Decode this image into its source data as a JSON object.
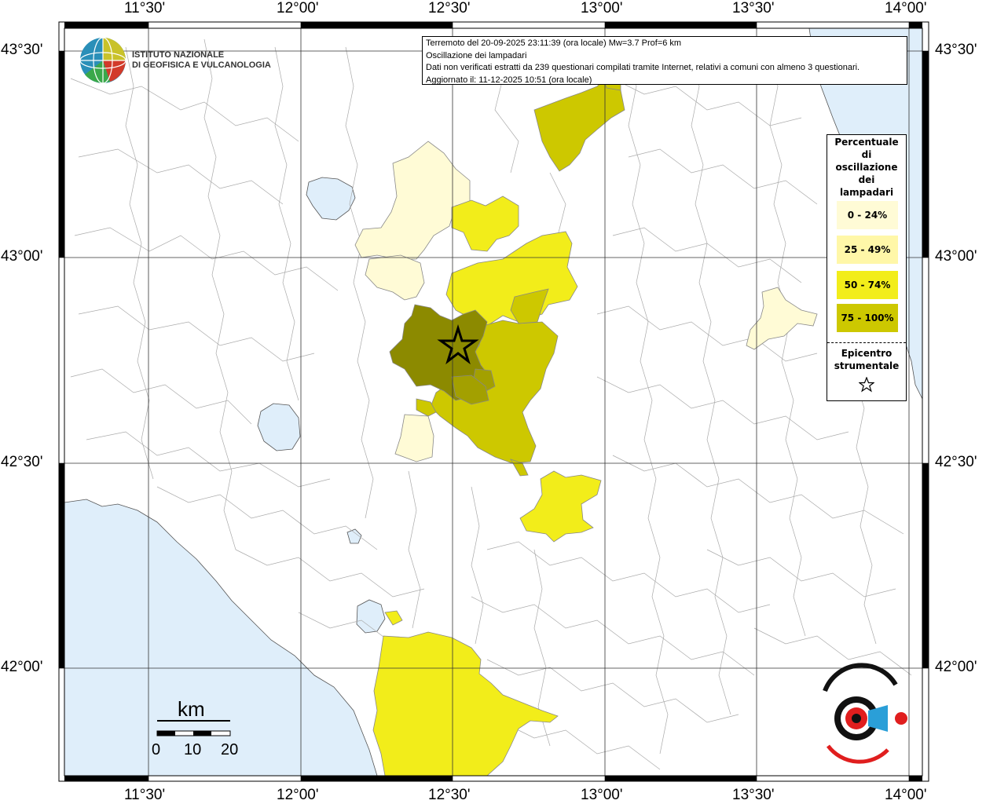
{
  "map": {
    "ticks_lon": [
      "11°30'",
      "12°00'",
      "12°30'",
      "13°00'",
      "13°30'",
      "14°00'"
    ],
    "ticks_lat": [
      "43°30'",
      "43°00'",
      "42°30'",
      "42°00'"
    ]
  },
  "info": {
    "line1": "Terremoto del 20-09-2025 23:11:39 (ora locale) Mw=3.7 Prof=6 km",
    "line2": "Oscillazione dei lampadari",
    "line3": "Dati non verificati estratti da 239 questionari compilati tramite Internet, relativi a comuni con almeno 3 questionari.",
    "line4": "Aggiornato il: 11-12-2025 10:51 (ora locale)"
  },
  "legend": {
    "title_lines": [
      "Percentuale",
      "di",
      "oscillazione",
      "dei",
      "lampadari"
    ],
    "classes": [
      {
        "label": "0 - 24%",
        "color": "#fffbd6"
      },
      {
        "label": "25 - 49%",
        "color": "#fff7a8"
      },
      {
        "label": "50 - 74%",
        "color": "#f2ed1a"
      },
      {
        "label": "75 - 100%",
        "color": "#cdc800"
      }
    ],
    "epicenter_lines": [
      "Epicentro",
      "strumentale"
    ]
  },
  "logo": {
    "line1": "ISTITUTO NAZIONALE",
    "line2": "DI GEOFISICA E VULCANOLOGIA"
  },
  "scale": {
    "unit": "km",
    "labels": [
      "0",
      "10",
      "20"
    ]
  },
  "colors": {
    "sea": "#dfeefa",
    "dark_olive": "#8c8a00",
    "olive": "#cdc800",
    "yellow": "#f2ed1a",
    "pale_yellow": "#fff7a8",
    "cream": "#fffbd6"
  }
}
